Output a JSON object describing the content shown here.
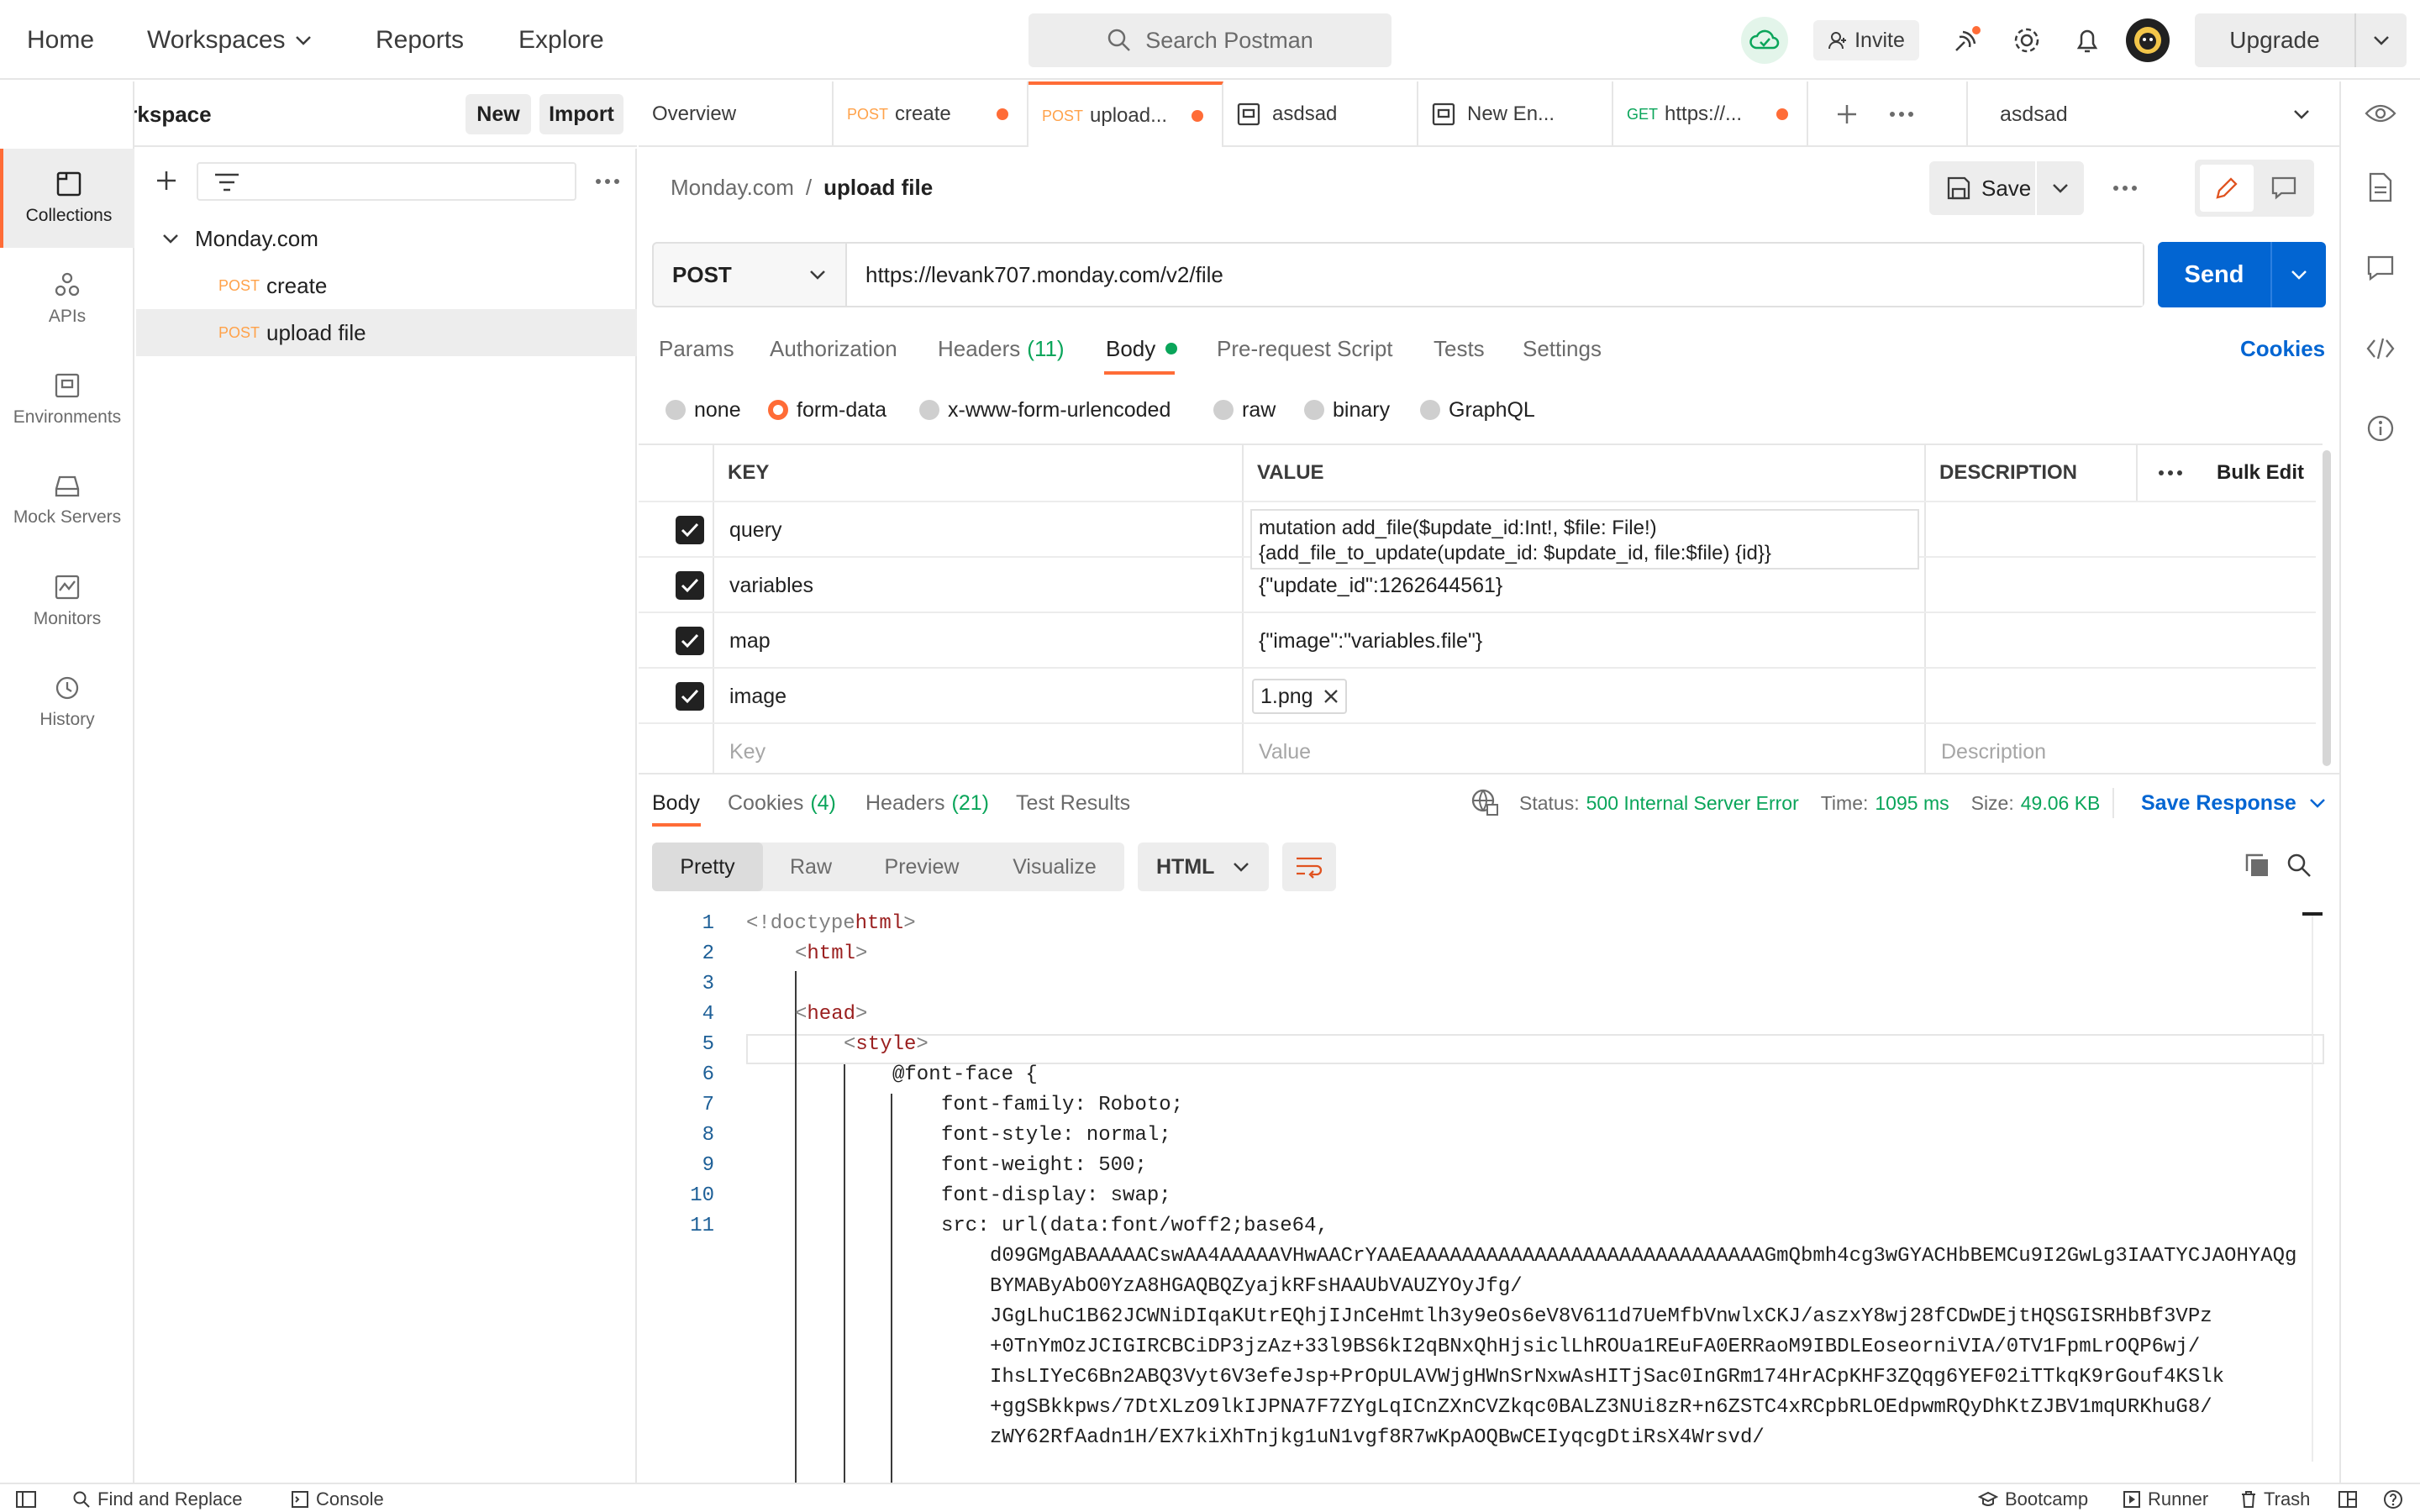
{
  "topbar": {
    "home": "Home",
    "workspaces": "Workspaces",
    "reports": "Reports",
    "explore": "Explore",
    "search_placeholder": "Search Postman",
    "invite": "Invite",
    "upgrade": "Upgrade"
  },
  "workspace": {
    "name": "My Workspace",
    "new_label": "New",
    "import_label": "Import"
  },
  "rail": [
    {
      "label": "Collections",
      "icon": "collections-icon"
    },
    {
      "label": "APIs",
      "icon": "apis-icon"
    },
    {
      "label": "Environments",
      "icon": "environments-icon"
    },
    {
      "label": "Mock Servers",
      "icon": "mock-servers-icon"
    },
    {
      "label": "Monitors",
      "icon": "monitors-icon"
    },
    {
      "label": "History",
      "icon": "history-icon"
    }
  ],
  "tree": {
    "collection": "Monday.com",
    "items": [
      {
        "method": "POST",
        "name": "create"
      },
      {
        "method": "POST",
        "name": "upload file"
      }
    ]
  },
  "tabs": [
    {
      "label": "Overview"
    },
    {
      "method": "POST",
      "label": "create"
    },
    {
      "method": "POST",
      "label": "upload..."
    },
    {
      "label": "asdsad"
    },
    {
      "label": "New En..."
    },
    {
      "method": "GET",
      "label": "https://..."
    }
  ],
  "environment": "asdsad",
  "breadcrumb": {
    "collection": "Monday.com",
    "separator": "/",
    "request": "upload file"
  },
  "save_label": "Save",
  "request": {
    "method": "POST",
    "url": "https://levank707.monday.com/v2/file",
    "send_label": "Send"
  },
  "subtabs": {
    "params": "Params",
    "authorization": "Authorization",
    "headers": "Headers",
    "headers_count": "(11)",
    "body": "Body",
    "prerequest": "Pre-request Script",
    "tests": "Tests",
    "settings": "Settings",
    "cookies": "Cookies"
  },
  "body_types": [
    "none",
    "form-data",
    "x-www-form-urlencoded",
    "raw",
    "binary",
    "GraphQL"
  ],
  "table": {
    "headers": {
      "key": "KEY",
      "value": "VALUE",
      "description": "DESCRIPTION",
      "bulk_edit": "Bulk Edit"
    },
    "rows": [
      {
        "key": "query",
        "value_line1": "mutation add_file($update_id:Int!, $file: File!)",
        "value_line2": "{add_file_to_update(update_id: $update_id, file:$file) {id}}"
      },
      {
        "key": "variables",
        "value": "{\"update_id\":1262644561}"
      },
      {
        "key": "map",
        "value": "{\"image\":\"variables.file\"}"
      },
      {
        "key": "image",
        "value": "1.png"
      }
    ],
    "placeholder_key": "Key",
    "placeholder_value": "Value",
    "placeholder_description": "Description"
  },
  "response": {
    "tabs": {
      "body": "Body",
      "cookies": "Cookies",
      "cookies_count": "(4)",
      "headers": "Headers",
      "headers_count": "(21)",
      "test_results": "Test Results"
    },
    "status_label": "Status:",
    "status_value": "500 Internal Server Error",
    "time_label": "Time:",
    "time_value": "1095 ms",
    "size_label": "Size:",
    "size_value": "49.06 KB",
    "save_response": "Save Response",
    "views": [
      "Pretty",
      "Raw",
      "Preview",
      "Visualize"
    ],
    "format": "HTML"
  },
  "code_lines": [
    {
      "n": "1",
      "parts": [
        [
          "punct",
          "<!doctype"
        ],
        [
          "tag",
          "html"
        ],
        [
          "punct",
          ">"
        ]
      ]
    },
    {
      "n": "2",
      "parts": [
        [
          "punct",
          "<"
        ],
        [
          "tag",
          "html"
        ],
        [
          "punct",
          ">"
        ]
      ]
    },
    {
      "n": "3",
      "parts": []
    },
    {
      "n": "4",
      "parts": [
        [
          "punct",
          "<"
        ],
        [
          "tag",
          "head"
        ],
        [
          "punct",
          ">"
        ]
      ]
    },
    {
      "n": "5",
      "parts": [
        [
          "punct",
          "<"
        ],
        [
          "tag",
          "style"
        ],
        [
          "punct",
          ">"
        ]
      ]
    },
    {
      "n": "6",
      "parts": [
        [
          "plain",
          "@font-face {"
        ]
      ]
    },
    {
      "n": "7",
      "parts": [
        [
          "plain",
          "font-family: Roboto;"
        ]
      ]
    },
    {
      "n": "8",
      "parts": [
        [
          "plain",
          "font-style: normal;"
        ]
      ]
    },
    {
      "n": "9",
      "parts": [
        [
          "plain",
          "font-weight: 500;"
        ]
      ]
    },
    {
      "n": "10",
      "parts": [
        [
          "plain",
          "font-display: swap;"
        ]
      ]
    },
    {
      "n": "11",
      "parts": [
        [
          "plain",
          "src: url(data:font/woff2;base64,"
        ]
      ]
    }
  ],
  "code_wrap": [
    "d09GMgABAAAAACswAA4AAAAAVHwAACrYAAEAAAAAAAAAAAAAAAAAAAAAAAAAAAAAGmQbmh4cg3wGYACHbBEMCu9I2GwLg3IAATYCJAOHYAQg",
    "BYMAByAbO0YzA8HGAQBQZyajkRFsHAAUbVAUZYOyJfg/",
    "JGgLhuC1B62JCWNiDIqaKUtrEQhjIJnCeHmtlh3y9eOs6eV8V611d7UeMfbVnwlxCKJ/aszxY8wj28fCDwDEjtHQSGISRHbBf3VPz",
    "+0TnYmOzJCIGIRCBCiDP3jzAz+33l9BS6kI2qBNxQhHjsiclLhROUa1REuFA0ERRaoM9IBDLEoseorniVIA/0TV1FpmLrOQP6wj/",
    "IhsLIYeC6Bn2ABQ3Vyt6V3efeJsp+PrOpULAVWjgHWnSrNxwAsHITjSac0InGRm174HrACpKHF3ZQqg6YEF02iTTkqK9rGouf4KSlk",
    "+ggSBkkpws/7DtXLzO9lkIJPNA7F7ZYgLqICnZXnCVZkqc0BALZ3NUi8zR+n6ZSTC4xRCpbRLOEdpwmRQyDhKtZJBV1mqURKhuG8/",
    "zWY62RfAadn1H/EX7kiXhTnjkg1uN1vgf8R7wKpAOQBwCEIyqcgDtiRsX4Wrsvd/"
  ],
  "footer": {
    "find_replace": "Find and Replace",
    "console": "Console",
    "bootcamp": "Bootcamp",
    "runner": "Runner",
    "trash": "Trash"
  },
  "colors": {
    "accent": "#ff6c37",
    "send": "#0265d2",
    "status_error": "#0aa55a",
    "post": "#ffa24a"
  }
}
